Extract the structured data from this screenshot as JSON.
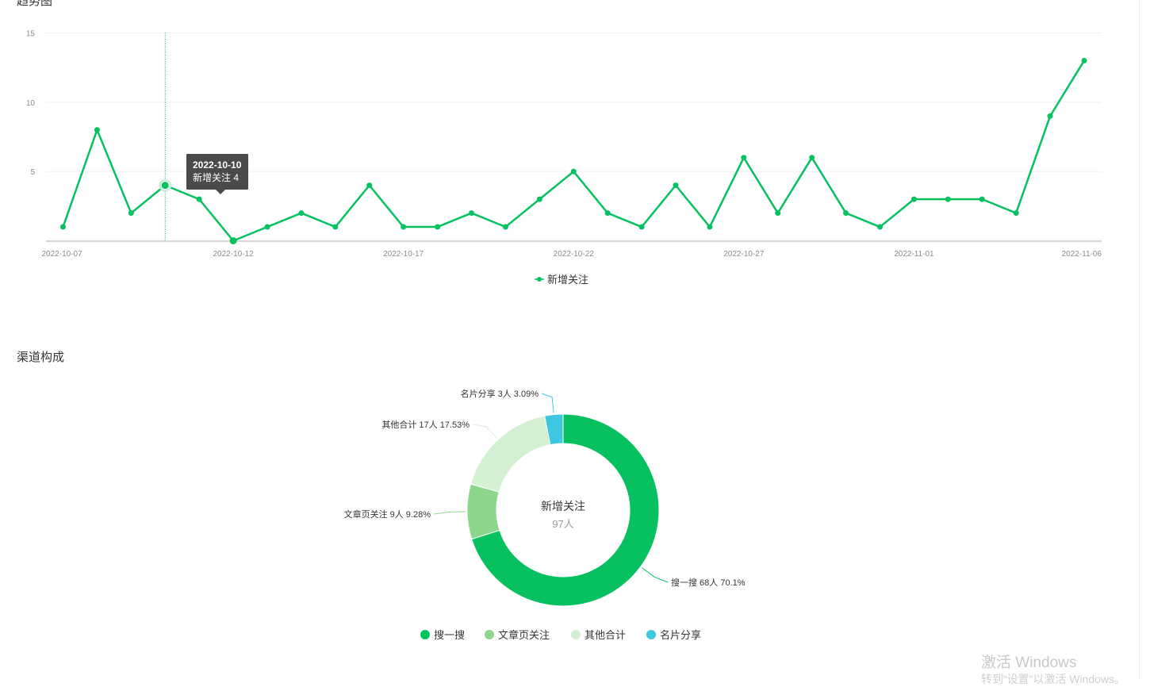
{
  "titles": {
    "trend": "趋势图",
    "channel": "渠道构成"
  },
  "tooltip": {
    "date": "2022-10-10",
    "text": "新增关注 4"
  },
  "watermark": {
    "line1": "激活 Windows",
    "line2": "转到“设置”以激活 Windows。"
  },
  "chart_data": [
    {
      "type": "line",
      "title": "趋势图",
      "series": [
        {
          "name": "新增关注",
          "color": "#07c160",
          "x": [
            "2022-10-07",
            "2022-10-08",
            "2022-10-09",
            "2022-10-10",
            "2022-10-11",
            "2022-10-12",
            "2022-10-13",
            "2022-10-14",
            "2022-10-15",
            "2022-10-16",
            "2022-10-17",
            "2022-10-18",
            "2022-10-19",
            "2022-10-20",
            "2022-10-21",
            "2022-10-22",
            "2022-10-23",
            "2022-10-24",
            "2022-10-25",
            "2022-10-26",
            "2022-10-27",
            "2022-10-28",
            "2022-10-29",
            "2022-10-30",
            "2022-10-31",
            "2022-11-01",
            "2022-11-02",
            "2022-11-03",
            "2022-11-04",
            "2022-11-05",
            "2022-11-06"
          ],
          "values": [
            1,
            8,
            2,
            4,
            3,
            0,
            1,
            2,
            1,
            4,
            1,
            1,
            2,
            1,
            3,
            5,
            2,
            1,
            4,
            1,
            6,
            2,
            6,
            2,
            1,
            3,
            3,
            3,
            2,
            9,
            13
          ]
        }
      ],
      "xticks": [
        "2022-10-07",
        "2022-10-12",
        "2022-10-17",
        "2022-10-22",
        "2022-10-27",
        "2022-11-01",
        "2022-11-06"
      ],
      "yticks": [
        "5",
        "10",
        "15"
      ],
      "ylim": [
        0,
        15
      ],
      "grid": true,
      "legend": "bottom",
      "highlighted": "2022-10-10"
    },
    {
      "type": "pie",
      "title": "渠道构成",
      "center": {
        "title": "新增关注",
        "value": "97人"
      },
      "slices": [
        {
          "name": "搜一搜",
          "value": 68,
          "percent": "70.1%",
          "label": "搜一搜 68人 70.1%",
          "color": "#07c160"
        },
        {
          "name": "文章页关注",
          "value": 9,
          "percent": "9.28%",
          "label": "文章页关注 9人 9.28%",
          "color": "#8ed68c"
        },
        {
          "name": "其他合计",
          "value": 17,
          "percent": "17.53%",
          "label": "其他合计 17人 17.53%",
          "color": "#d3f0d2"
        },
        {
          "name": "名片分享",
          "value": 3,
          "percent": "3.09%",
          "label": "名片分享 3人 3.09%",
          "color": "#3ec8e0"
        }
      ],
      "legend": "bottom"
    }
  ]
}
